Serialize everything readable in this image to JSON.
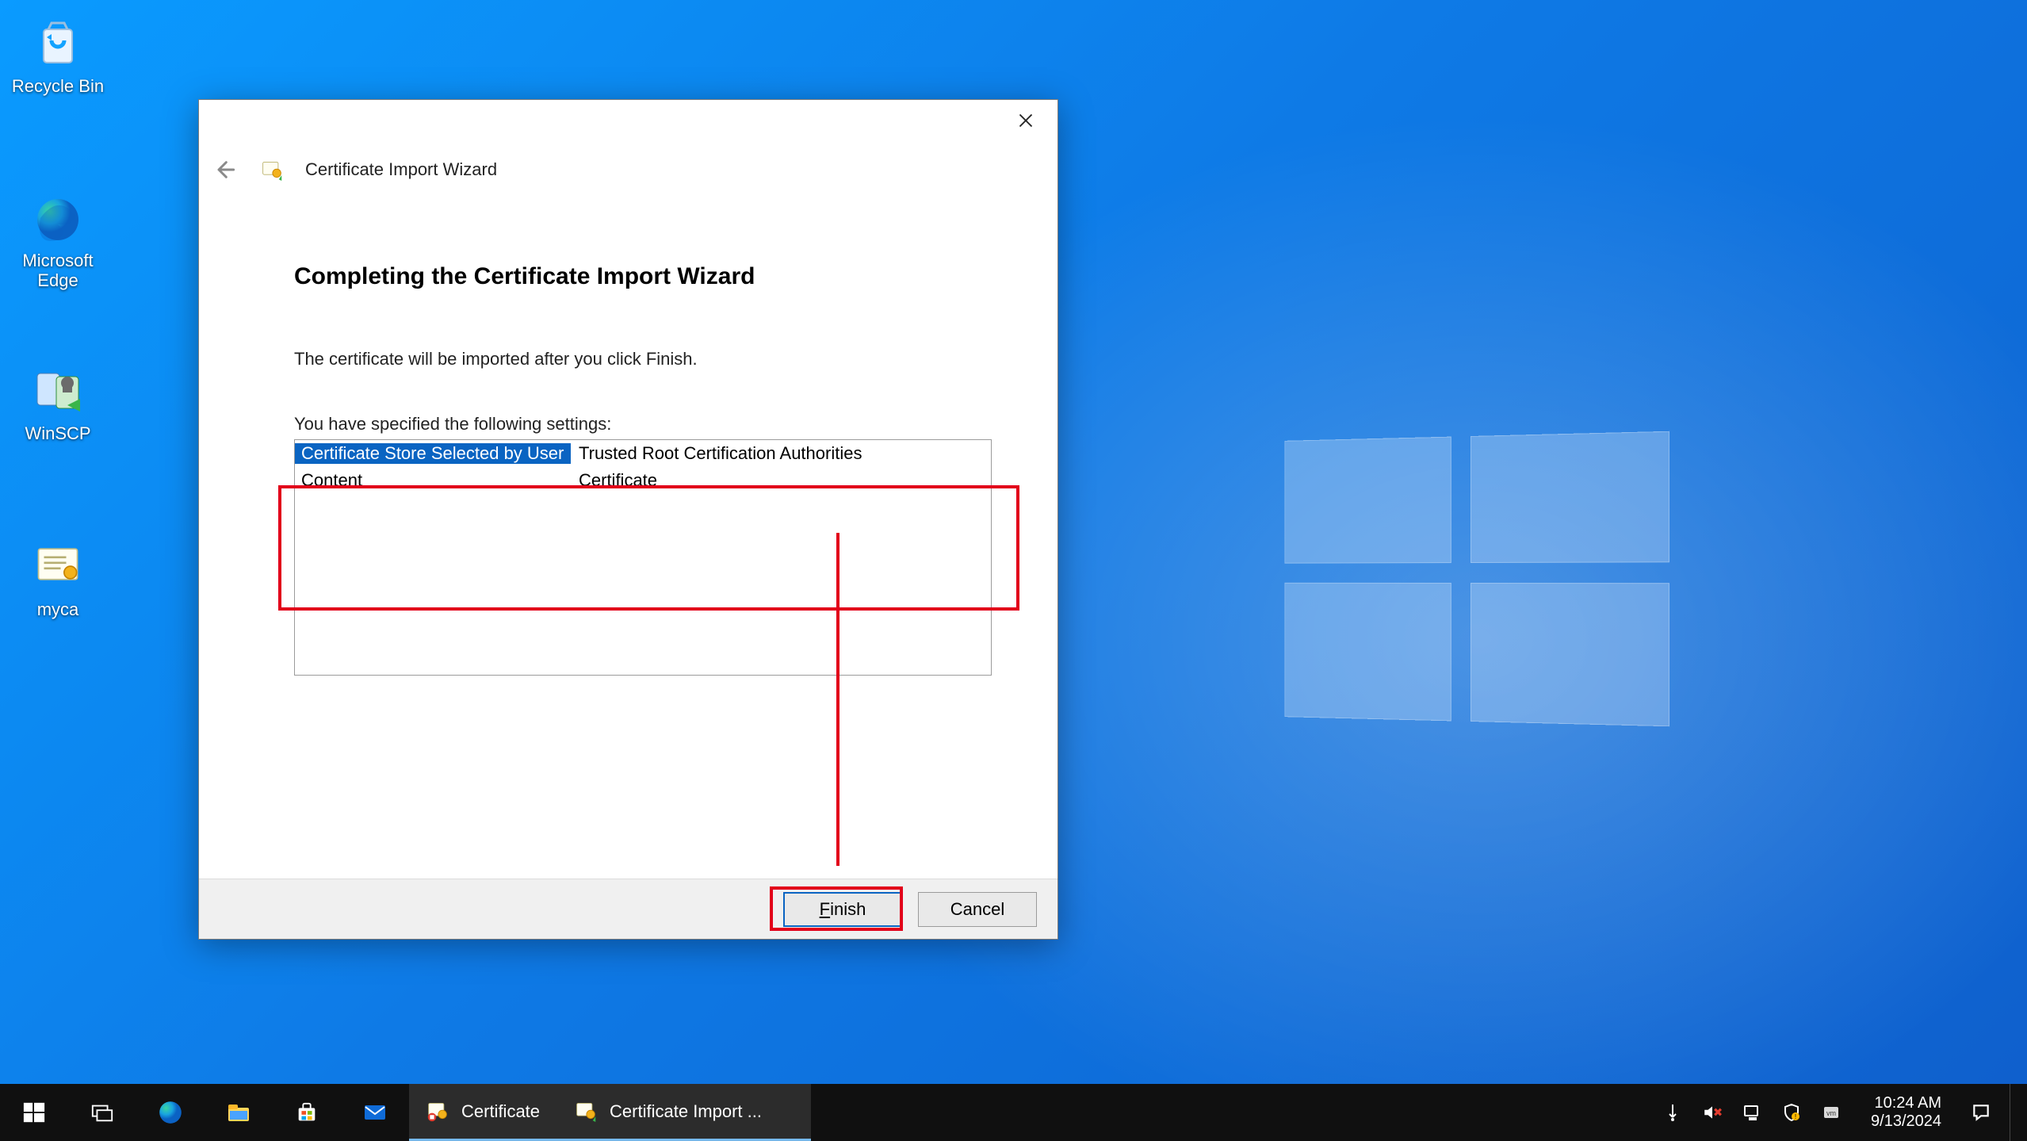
{
  "desktop": {
    "icons": [
      {
        "name": "recycle-bin",
        "label": "Recycle Bin"
      },
      {
        "name": "microsoft-edge",
        "label": "Microsoft Edge"
      },
      {
        "name": "winscp",
        "label": "WinSCP"
      },
      {
        "name": "myca",
        "label": "myca"
      }
    ]
  },
  "wizard": {
    "crumb": "Certificate Import Wizard",
    "title": "Completing the Certificate Import Wizard",
    "lead": "The certificate will be imported after you click Finish.",
    "settings_heading": "You have specified the following settings:",
    "rows": [
      {
        "key": "Certificate Store Selected by User",
        "value": "Trusted Root Certification Authorities"
      },
      {
        "key": "Content",
        "value": "Certificate"
      }
    ],
    "buttons": {
      "finish": "Finish",
      "cancel": "Cancel"
    }
  },
  "taskbar": {
    "apps": [
      {
        "name": "certificate-window",
        "label": "Certificate"
      },
      {
        "name": "certificate-import-wizard",
        "label": "Certificate Import ..."
      }
    ],
    "clock": {
      "time": "10:24 AM",
      "date": "9/13/2024"
    }
  },
  "annotations": {
    "highlight_color": "#e2001a"
  }
}
